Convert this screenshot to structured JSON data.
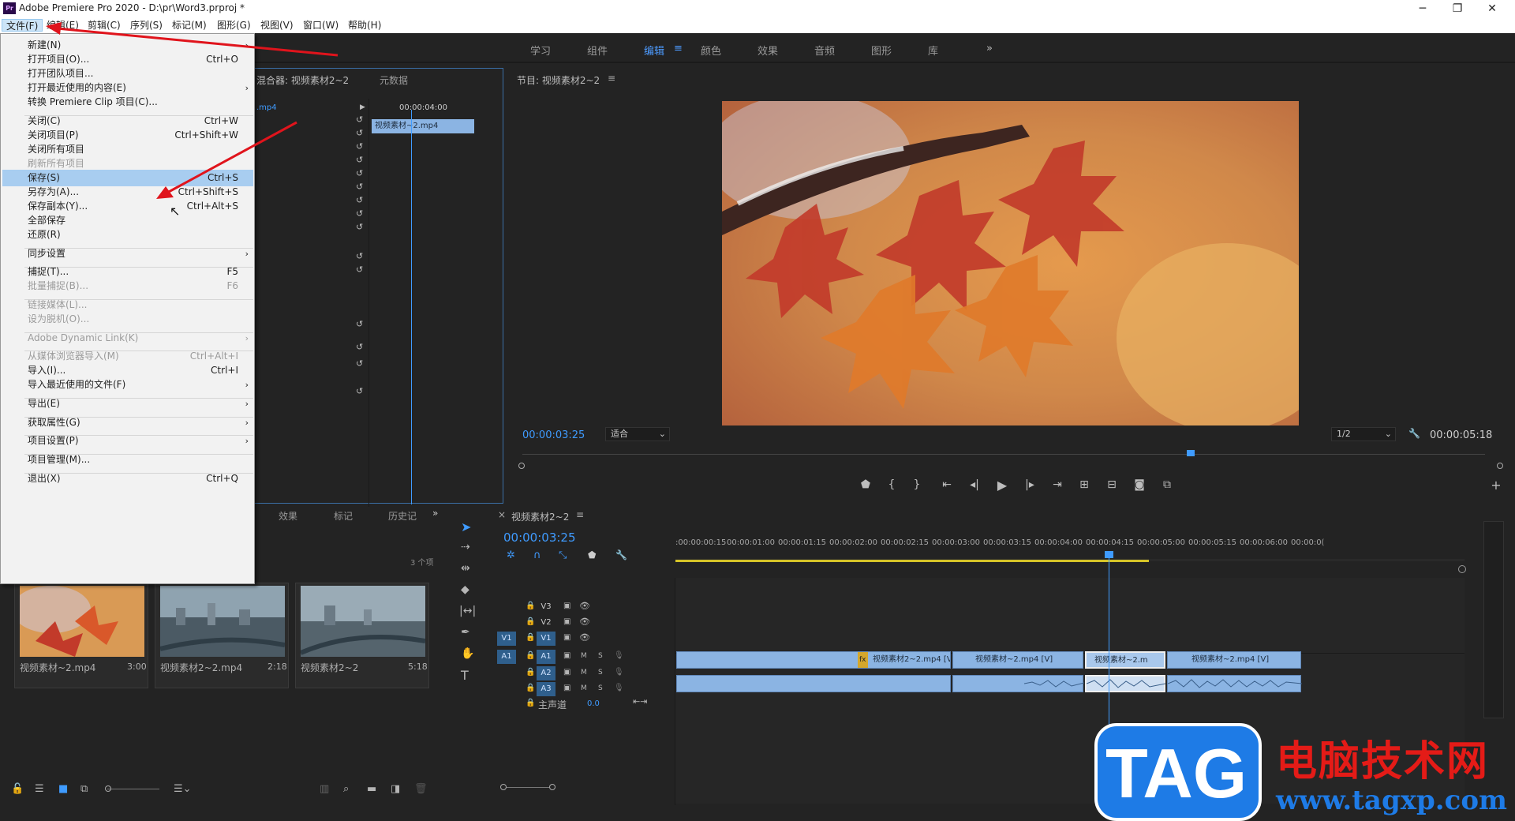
{
  "window": {
    "title": "Adobe Premiere Pro 2020 - D:\\pr\\Word3.prproj *",
    "app_icon": "Pr",
    "minimize": "─",
    "maximize": "❐",
    "close": "✕"
  },
  "menubar": [
    "文件(F)",
    "编辑(E)",
    "剪辑(C)",
    "序列(S)",
    "标记(M)",
    "图形(G)",
    "视图(V)",
    "窗口(W)",
    "帮助(H)"
  ],
  "workspaces": [
    "学习",
    "组件",
    "编辑",
    "颜色",
    "效果",
    "音频",
    "图形",
    "库"
  ],
  "workspace_more": "»",
  "file_menu": [
    {
      "label": "新建(N)",
      "shortcut": "",
      "submenu": true,
      "disabled": false
    },
    {
      "label": "打开项目(O)...",
      "shortcut": "Ctrl+O",
      "submenu": false,
      "disabled": false
    },
    {
      "label": "打开团队项目...",
      "shortcut": "",
      "submenu": false,
      "disabled": false
    },
    {
      "label": "打开最近使用的内容(E)",
      "shortcut": "",
      "submenu": true,
      "disabled": false
    },
    {
      "label": "转换 Premiere Clip 项目(C)...",
      "shortcut": "",
      "submenu": false,
      "disabled": false
    },
    {
      "label": "关闭(C)",
      "shortcut": "Ctrl+W",
      "submenu": false,
      "disabled": false
    },
    {
      "label": "关闭项目(P)",
      "shortcut": "Ctrl+Shift+W",
      "submenu": false,
      "disabled": false
    },
    {
      "label": "关闭所有项目",
      "shortcut": "",
      "submenu": false,
      "disabled": false
    },
    {
      "label": "刷新所有项目",
      "shortcut": "",
      "submenu": false,
      "disabled": true
    },
    {
      "label": "保存(S)",
      "shortcut": "Ctrl+S",
      "submenu": false,
      "disabled": false
    },
    {
      "label": "另存为(A)...",
      "shortcut": "Ctrl+Shift+S",
      "submenu": false,
      "disabled": false
    },
    {
      "label": "保存副本(Y)...",
      "shortcut": "Ctrl+Alt+S",
      "submenu": false,
      "disabled": false
    },
    {
      "label": "全部保存",
      "shortcut": "",
      "submenu": false,
      "disabled": false
    },
    {
      "label": "还原(R)",
      "shortcut": "",
      "submenu": false,
      "disabled": false
    },
    {
      "label": "同步设置",
      "shortcut": "",
      "submenu": true,
      "disabled": false
    },
    {
      "label": "捕捉(T)...",
      "shortcut": "F5",
      "submenu": false,
      "disabled": false
    },
    {
      "label": "批量捕捉(B)...",
      "shortcut": "F6",
      "submenu": false,
      "disabled": true
    },
    {
      "label": "链接媒体(L)...",
      "shortcut": "",
      "submenu": false,
      "disabled": true
    },
    {
      "label": "设为脱机(O)...",
      "shortcut": "",
      "submenu": false,
      "disabled": true
    },
    {
      "label": "Adobe Dynamic Link(K)",
      "shortcut": "",
      "submenu": true,
      "disabled": true
    },
    {
      "label": "从媒体浏览器导入(M)",
      "shortcut": "Ctrl+Alt+I",
      "submenu": false,
      "disabled": true
    },
    {
      "label": "导入(I)...",
      "shortcut": "Ctrl+I",
      "submenu": false,
      "disabled": false
    },
    {
      "label": "导入最近使用的文件(F)",
      "shortcut": "",
      "submenu": true,
      "disabled": false
    },
    {
      "label": "导出(E)",
      "shortcut": "",
      "submenu": true,
      "disabled": false
    },
    {
      "label": "获取属性(G)",
      "shortcut": "",
      "submenu": true,
      "disabled": false
    },
    {
      "label": "项目设置(P)",
      "shortcut": "",
      "submenu": true,
      "disabled": false
    },
    {
      "label": "项目管理(M)...",
      "shortcut": "",
      "submenu": false,
      "disabled": false
    },
    {
      "label": "退出(X)",
      "shortcut": "Ctrl+Q",
      "submenu": false,
      "disabled": false
    }
  ],
  "source_panel": {
    "tab_mixer": "混合器: 视频素材2~2",
    "tab_meta": "元数据",
    "clip_ref": ".mp4",
    "mini_tc": "00:00:04:00",
    "mini_clip": "视频素材~2.mp4"
  },
  "program": {
    "title": "节目: 视频素材2~2",
    "menu_icon": "≡",
    "timecode": "00:00:03:25",
    "fit": "适合",
    "quality": "1/2",
    "duration": "00:00:05:18"
  },
  "project_panel": {
    "tabs": [
      "效果",
      "标记",
      "历史记"
    ],
    "more": "»",
    "count": "3 个项",
    "items": [
      {
        "name": "视频素材~2.mp4",
        "duration": "3:00"
      },
      {
        "name": "视频素材2~2.mp4",
        "duration": "2:18"
      },
      {
        "name": "视频素材2~2",
        "duration": "5:18"
      }
    ]
  },
  "timeline": {
    "title": "视频素材2~2",
    "close": "×",
    "menu_icon": "≡",
    "timecode": "00:00:03:25",
    "ruler": [
      ":00:00:00:15",
      "00:00:01:00",
      "00:00:01:15",
      "00:00:02:00",
      "00:00:02:15",
      "00:00:03:00",
      "00:00:03:15",
      "00:00:04:00",
      "00:00:04:15",
      "00:00:05:00",
      "00:00:05:15",
      "00:00:06:00",
      "00:00:0("
    ],
    "tracks_v": [
      "V3",
      "V2",
      "V1"
    ],
    "tracks_a": [
      "A1",
      "A2",
      "A3"
    ],
    "src_v": "V1",
    "src_a": "A1",
    "master": "主声道",
    "master_val": "0.0",
    "M": "M",
    "S": "S",
    "clips": [
      "视频素材2~2.mp4 [V]",
      "视频素材~2.mp4 [V]",
      "视频素材~2.m",
      "视频素材~2.mp4 [V]"
    ],
    "fx": "fx"
  },
  "watermark": {
    "tag": "TAG",
    "site_cn": "电脑技术网",
    "url": "www.tagxp.com"
  },
  "colors": {
    "accent": "#3f9bff",
    "clip": "#8bb4e3",
    "menu_hover": "#a8cdf0",
    "arrow": "#e0141c"
  }
}
